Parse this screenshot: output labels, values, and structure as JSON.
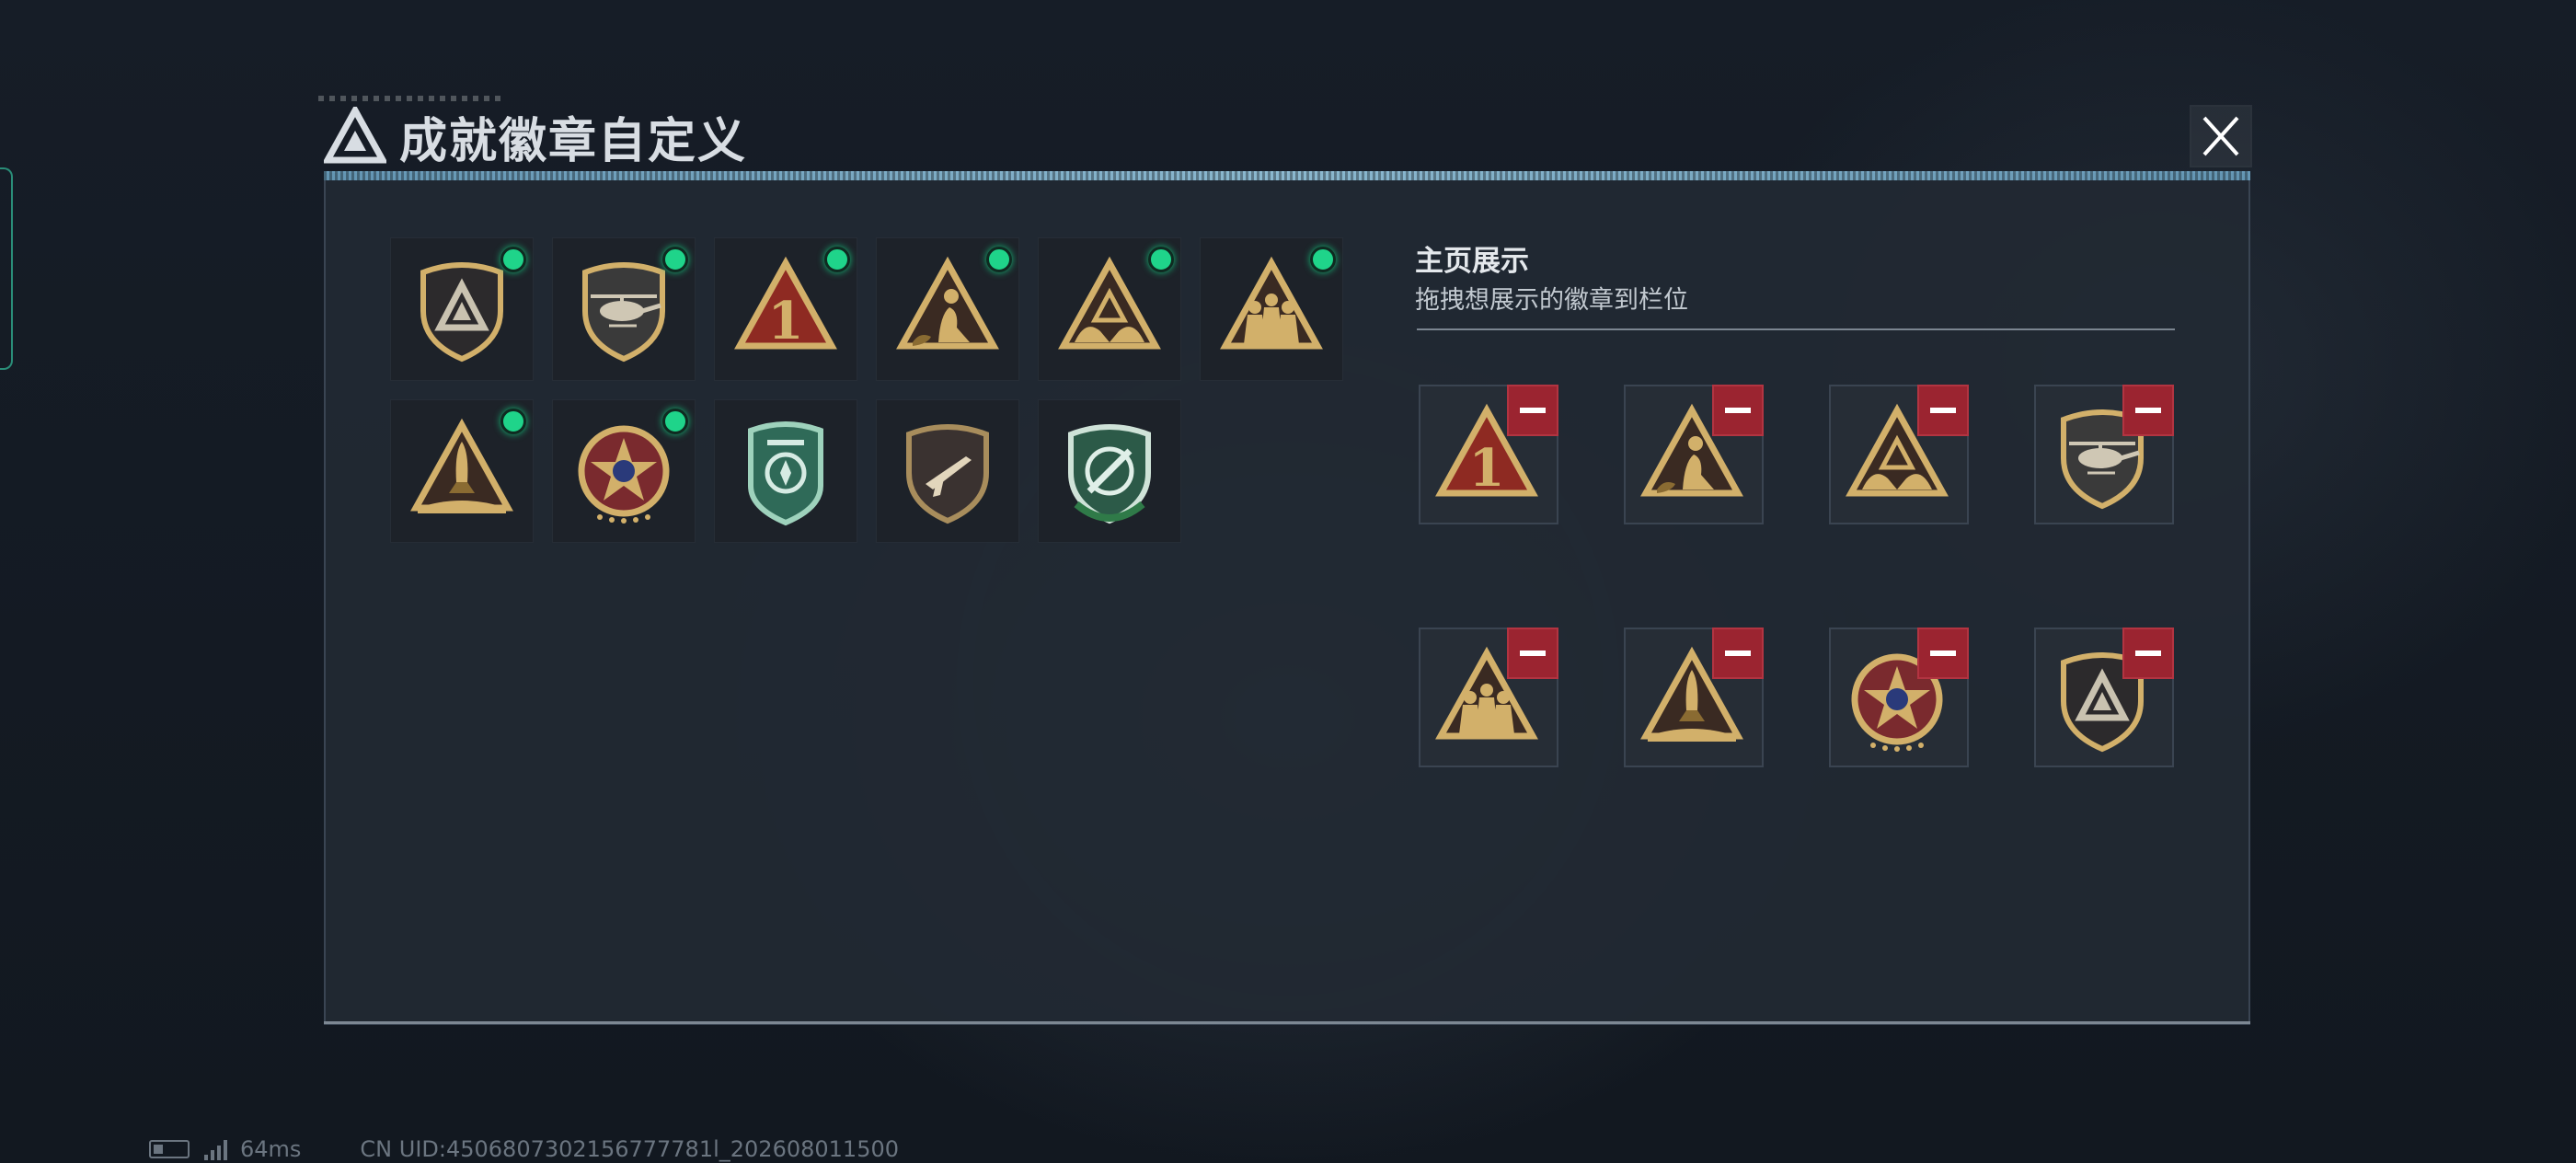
{
  "header": {
    "title": "成就徽章自定义",
    "logo_icon": "triangle-logo-icon",
    "close_icon": "close-x-icon"
  },
  "inventory": {
    "badges": [
      {
        "name": "triangle-shield-badge",
        "equipped": true
      },
      {
        "name": "helicopter-shield-badge",
        "equipped": true
      },
      {
        "name": "number-one-triangle-badge",
        "equipped": true
      },
      {
        "name": "soldier-triangle-badge",
        "equipped": true
      },
      {
        "name": "hands-triangle-badge",
        "equipped": true
      },
      {
        "name": "squad-triangle-badge",
        "equipped": true
      },
      {
        "name": "rocket-triangle-badge",
        "equipped": true
      },
      {
        "name": "star-medal-badge",
        "equipped": true
      },
      {
        "name": "green-emblem-badge",
        "equipped": false
      },
      {
        "name": "rifle-shield-badge",
        "equipped": false
      },
      {
        "name": "green-crosshair-badge",
        "equipped": false
      }
    ]
  },
  "showcase": {
    "title": "主页展示",
    "subtitle": "拖拽想展示的徽章到栏位",
    "slots": [
      {
        "name": "number-one-triangle-badge"
      },
      {
        "name": "soldier-triangle-badge"
      },
      {
        "name": "hands-triangle-badge"
      },
      {
        "name": "helicopter-shield-badge"
      },
      {
        "name": "squad-triangle-badge"
      },
      {
        "name": "rocket-triangle-badge"
      },
      {
        "name": "star-medal-badge"
      },
      {
        "name": "triangle-shield-badge"
      }
    ],
    "remove_icon": "minus-icon"
  },
  "status_bar": {
    "ping": "64ms",
    "uid": "CN UID:4506807302156777781l_202608011500",
    "battery_icon": "battery-icon",
    "signal_icon": "signal-icon"
  },
  "colors": {
    "accent_line": "#9ed1ea",
    "equipped_dot": "#1fd48a",
    "remove_button": "#9b2430",
    "badge_gold": "#d2b06a",
    "badge_red": "#8e2a22"
  }
}
